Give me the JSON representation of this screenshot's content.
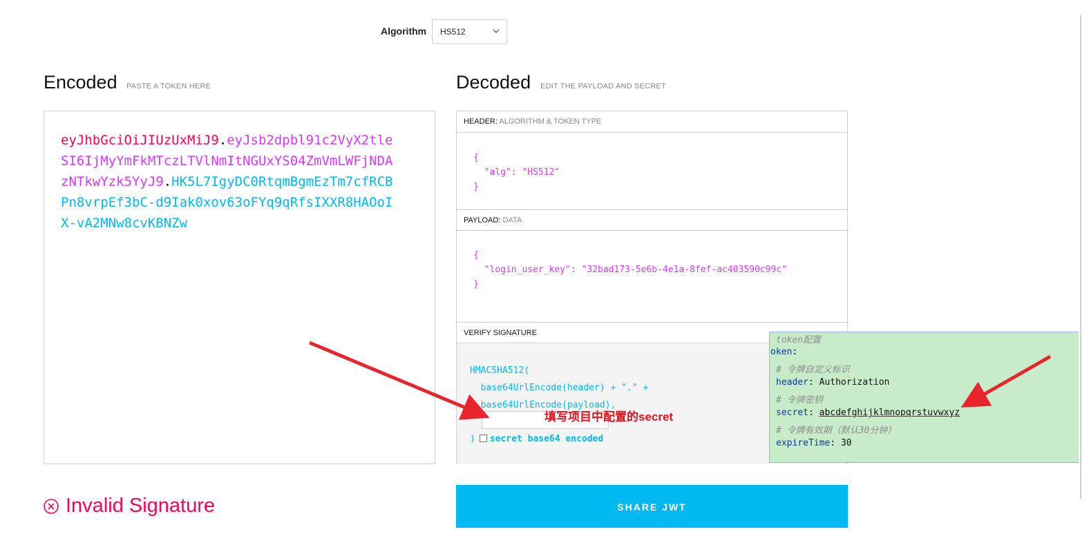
{
  "algorithm": {
    "label": "Algorithm",
    "selected": "HS512"
  },
  "encoded": {
    "title": "Encoded",
    "subtitle": "PASTE A TOKEN HERE",
    "token_header": "eyJhbGciOiJIUzUxMiJ9",
    "token_payload": "eyJsb2dpbl91c2VyX2tleSI6IjMyYmFkMTczLTVlNmItNGUxYS04ZmVmLWFjNDAzNTkwYzk5YyJ9",
    "token_signature": "HK5L7IgyDC0RtqmBgmEzTm7cfRCBPn8vrpEf3bC-d9Iak0xov63oFYq9qRfsIXXR8HAOoIX-vA2MNw8cvKBNZw"
  },
  "decoded": {
    "title": "Decoded",
    "subtitle": "EDIT THE PAYLOAD AND SECRET",
    "header_label": "HEADER:",
    "header_sub": "ALGORITHM & TOKEN TYPE",
    "header_json": "{\n  \"alg\": \"HS512\"\n}",
    "payload_label": "PAYLOAD:",
    "payload_sub": "DATA",
    "payload_json": "{\n  \"login_user_key\": \"32bad173-5e6b-4e1a-8fef-ac403590c99c\"\n}",
    "verify_label": "VERIFY SIGNATURE",
    "verify_code": "HMACSHA512(\n  base64UrlEncode(header) + \".\" +\n  base64UrlEncode(payload),",
    "verify_close": ")",
    "secret_base64_label": "secret base64 encoded"
  },
  "annotation": {
    "text": "填写项目中配置的secret",
    "color": "#e0141e"
  },
  "config": {
    "lines": [
      {
        "type": "comment",
        "text": "token配置"
      },
      {
        "type": "key",
        "key": "oken",
        "value": ""
      },
      {
        "type": "comment",
        "text": "# 令牌自定义标识"
      },
      {
        "type": "key",
        "key": "header",
        "value": "Authorization"
      },
      {
        "type": "comment",
        "text": "# 令牌密钥"
      },
      {
        "type": "key",
        "key": "secret",
        "value": "abcdefghijklmnopqrstuvwxyz"
      },
      {
        "type": "comment",
        "text": "# 令牌有效期（默认30分钟）"
      },
      {
        "type": "key",
        "key": "expireTime",
        "value": "30"
      }
    ]
  },
  "status": {
    "text": "Invalid Signature",
    "color": "#fb015b"
  },
  "share_button": {
    "label": "SHARE JWT"
  },
  "colors": {
    "accent": "#00b9f1",
    "red": "#fb015b",
    "purple": "#d63aff"
  }
}
